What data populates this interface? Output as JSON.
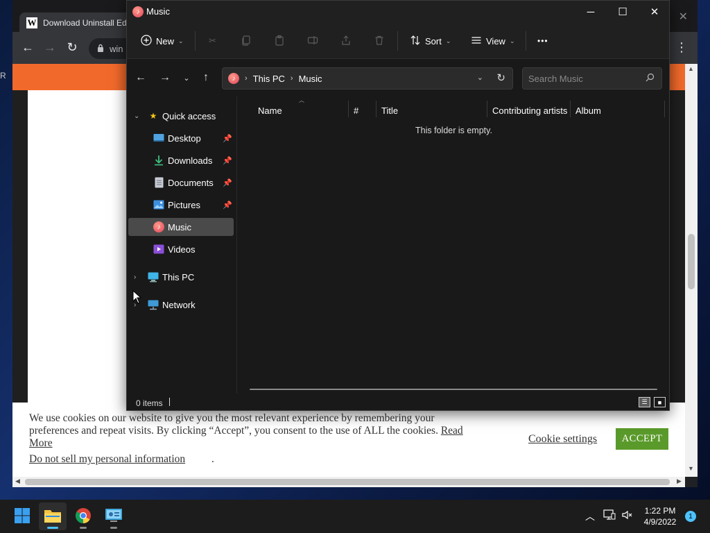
{
  "browser": {
    "tab_title": "Download Uninstall Ed",
    "tab_favicon": "W",
    "address_partial": "win",
    "left_edge_text": "R",
    "accent_orange": "#f26a2b"
  },
  "cookie_banner": {
    "message": "We use cookies on our website to give you the most relevant experience by remembering your preferences and repeat visits. By clicking “Accept”, you consent to the use of ALL the cookies.",
    "read_more": "Read More",
    "do_not_sell": "Do not sell my personal information",
    "do_not_sell_suffix": ".",
    "settings_label": "Cookie settings",
    "accept_label": "ACCEPT",
    "accept_color": "#5a9a2a"
  },
  "explorer": {
    "window_title": "Music",
    "commands": {
      "new_label": "New",
      "sort_label": "Sort",
      "view_label": "View",
      "more_label": "•••"
    },
    "address": {
      "crumbs": [
        "This PC",
        "Music"
      ]
    },
    "search": {
      "placeholder": "Search Music"
    },
    "nav": {
      "quick_access": "Quick access",
      "items": [
        {
          "label": "Desktop",
          "icon": "desktop-icon",
          "pinned": true
        },
        {
          "label": "Downloads",
          "icon": "download-icon",
          "pinned": true
        },
        {
          "label": "Documents",
          "icon": "document-icon",
          "pinned": true
        },
        {
          "label": "Pictures",
          "icon": "pictures-icon",
          "pinned": true
        },
        {
          "label": "Music",
          "icon": "music-icon",
          "pinned": false,
          "selected": true
        },
        {
          "label": "Videos",
          "icon": "videos-icon",
          "pinned": false
        }
      ],
      "this_pc": "This PC",
      "network": "Network"
    },
    "columns": [
      "Name",
      "#",
      "Title",
      "Contributing artists",
      "Album"
    ],
    "empty_message": "This folder is empty.",
    "status": {
      "item_count": "0 items"
    }
  },
  "taskbar": {
    "time": "1:22 PM",
    "date": "4/9/2022",
    "notification_count": "1",
    "accent": "#4cc2ff"
  }
}
